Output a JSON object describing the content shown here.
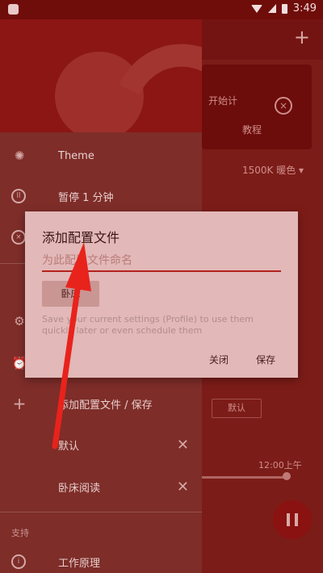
{
  "status_bar": {
    "time": "3:49"
  },
  "background": {
    "card_line1": "开始计",
    "card_line2": "教程",
    "dropdown_value": "1500K 暖色",
    "button_label": "默认",
    "time_label": "12:00上午"
  },
  "drawer": {
    "items": [
      {
        "label": "Theme",
        "icon": "theme-icon"
      },
      {
        "label": "暂停 1 分钟",
        "icon": "pause-icon"
      }
    ],
    "section_label": "支持",
    "add_profile_label": "添加配置文件 / 保存",
    "profiles": [
      {
        "label": "默认"
      },
      {
        "label": "卧床阅读"
      }
    ],
    "support_item_label": "工作原理"
  },
  "dialog": {
    "title": "添加配置文件",
    "input_placeholder": "为此配置文件命名",
    "chip_label": "卧床",
    "hint": "Save your current settings (Profile) to use them quickly later or even schedule them",
    "cancel_label": "关闭",
    "save_label": "保存"
  },
  "colors": {
    "accent": "#b3221c",
    "annotation_arrow": "#e8231c"
  }
}
